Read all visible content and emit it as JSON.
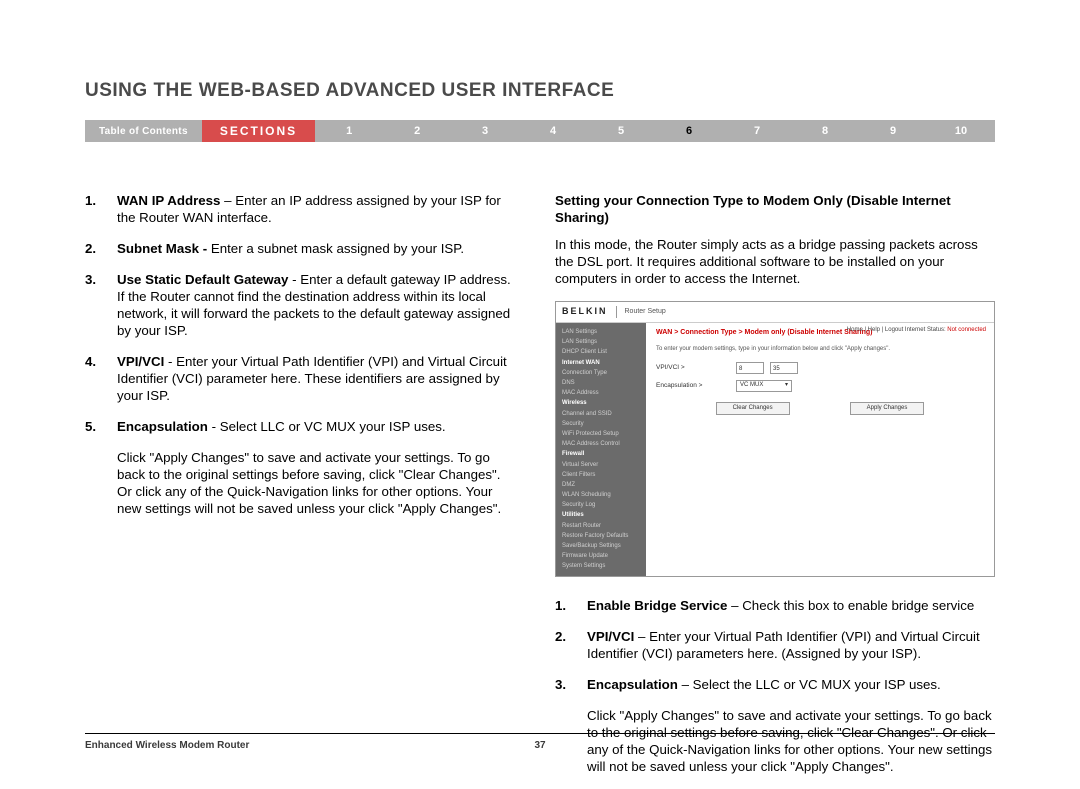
{
  "title": "USING THE WEB-BASED ADVANCED USER INTERFACE",
  "nav": {
    "toc": "Table of Contents",
    "sections_label": "SECTIONS",
    "items": [
      "1",
      "2",
      "3",
      "4",
      "5",
      "6",
      "7",
      "8",
      "9",
      "10"
    ],
    "active": "6"
  },
  "left": {
    "items": [
      {
        "n": "1.",
        "b": "WAN IP Address",
        "t": " – Enter an IP address assigned by your ISP for the Router WAN interface."
      },
      {
        "n": "2.",
        "b": "Subnet Mask - ",
        "t": "Enter a subnet mask assigned by your ISP."
      },
      {
        "n": "3.",
        "b": "Use Static Default Gateway ",
        "t": " - Enter a default gateway IP address. If the Router cannot find the destination address within its local network, it will forward the packets to the default gateway assigned by your ISP."
      },
      {
        "n": "4.",
        "b": "VPI/VCI",
        "t": " - Enter your Virtual Path Identifier (VPI) and Virtual Circuit Identifier (VCI) parameter here. These identifiers are assigned by your ISP."
      },
      {
        "n": "5.",
        "b": "Encapsulation",
        "t": " - Select LLC or VC MUX your ISP uses."
      }
    ],
    "para": "Click \"Apply Changes\" to save and activate your settings. To go back to the original settings before saving, click \"Clear Changes\". Or click any of the Quick-Navigation links for other options. Your new settings will not be saved unless your click \"Apply Changes\"."
  },
  "right": {
    "subhead": "Setting your Connection Type to Modem Only (Disable Internet Sharing)",
    "intro": "In this mode, the Router simply acts as a bridge passing packets across the DSL port. It requires additional software to be installed on your computers in order to access the Internet.",
    "shot": {
      "logo": "BELKIN",
      "title": "Router Setup",
      "meta_links": "Home | Help | Logout   Internet Status:",
      "meta_status": "Not connected",
      "breadcrumb": "WAN > Connection Type > Modem only (Disable Internet Sharing)",
      "hint": "To enter your modem settings, type in your information below and click \"Apply changes\".",
      "vpi_label": "VPI/VCI >",
      "vpi_a": "8",
      "vpi_b": "35",
      "enc_label": "Encapsulation >",
      "enc_value": "VC MUX",
      "btn_clear": "Clear Changes",
      "btn_apply": "Apply Changes",
      "sidebar": [
        "LAN Settings",
        "LAN Settings",
        "DHCP Client List",
        "Internet WAN",
        "Connection Type",
        "DNS",
        "MAC Address",
        "Wireless",
        "Channel and SSID",
        "Security",
        "WiFi Protected Setup",
        "MAC Address Control",
        "Firewall",
        "Virtual Server",
        "Client Filters",
        "DMZ",
        "WLAN Scheduling",
        "Security Log",
        "Utilities",
        "Restart Router",
        "Restore Factory Defaults",
        "Save/Backup Settings",
        "Firmware Update",
        "System Settings"
      ]
    },
    "items": [
      {
        "n": "1.",
        "b": "Enable Bridge Service",
        "t": " – Check this box to enable bridge service"
      },
      {
        "n": "2.",
        "b": "VPI/VCI",
        "t": " – Enter your Virtual Path Identifier (VPI) and Virtual Circuit Identifier (VCI) parameters here. (Assigned by your ISP)."
      },
      {
        "n": "3.",
        "b": "Encapsulation",
        "t": " – Select the LLC or VC MUX your ISP uses."
      }
    ],
    "para": "Click \"Apply Changes\" to save and activate your settings. To go back to the original settings before saving, click \"Clear Changes\". Or click any of the Quick-Navigation links for other options. Your new settings will not be saved unless your click \"Apply Changes\"."
  },
  "footer": {
    "product": "Enhanced Wireless Modem Router",
    "page": "37"
  }
}
